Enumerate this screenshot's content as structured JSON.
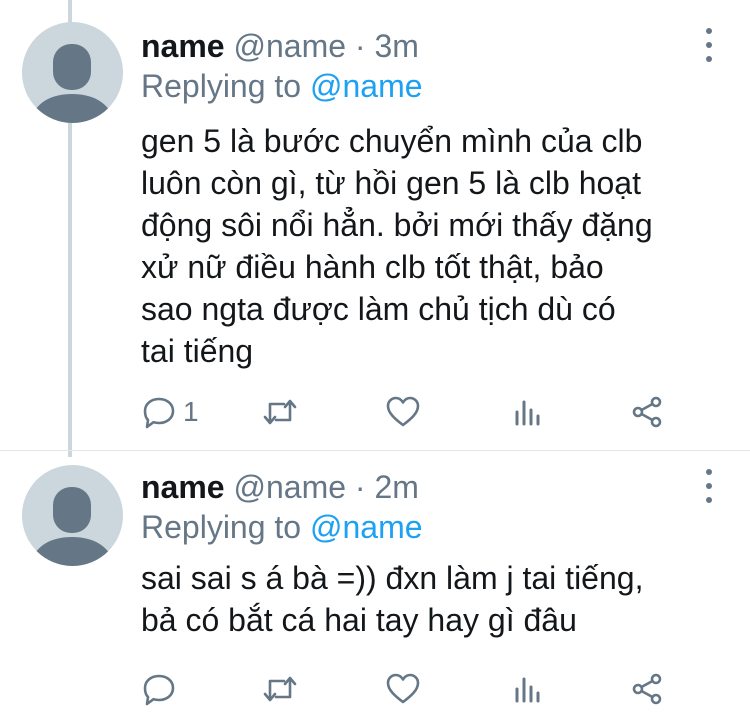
{
  "tweets": [
    {
      "display_name": "name",
      "handle": "@name",
      "separator": "·",
      "time": "3m",
      "replying_prefix": "Replying to",
      "replying_to": "@name",
      "text": "gen 5 là bước chuyển mình của clb\nluôn còn gì, từ hồi gen 5 là clb hoạt\nđộng sôi nổi hẳn. bởi mới thấy đặng\nxử nữ điều hành clb tốt thật, bảo\nsao ngta được làm chủ tịch dù có\ntai tiếng",
      "reply_count": "1"
    },
    {
      "display_name": "name",
      "handle": "@name",
      "separator": "·",
      "time": "2m",
      "replying_prefix": "Replying to",
      "replying_to": "@name",
      "text": "sai sai s á bà =)) đxn làm j tai tiếng,\nbả có bắt cá hai tay hay gì đâu",
      "reply_count": ""
    }
  ],
  "icons": {
    "more": "more-vertical-icon",
    "reply": "reply-icon",
    "retweet": "retweet-icon",
    "like": "heart-icon",
    "stats": "analytics-icon",
    "share": "share-icon"
  },
  "colors": {
    "text": "#14171a",
    "secondary": "#657786",
    "accent": "#1da1f2",
    "avatar_bg": "#ccd6dd",
    "avatar_fg": "#657786"
  }
}
